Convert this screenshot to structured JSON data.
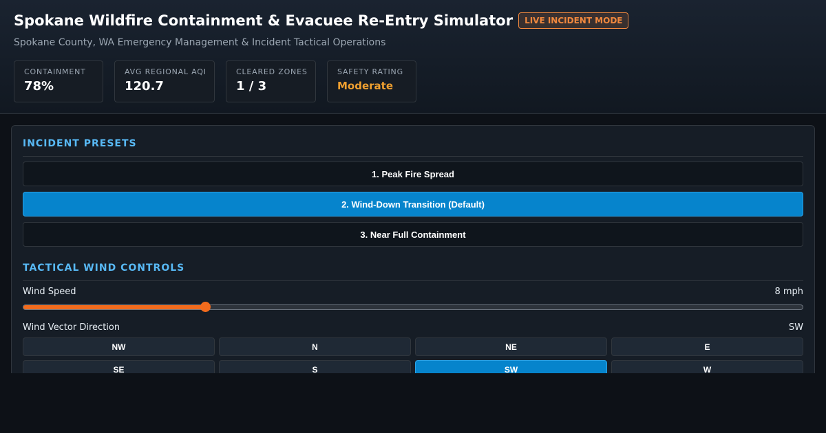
{
  "header": {
    "title": "Spokane Wildfire Containment & Evacuee Re-Entry Simulator",
    "live_badge": "LIVE INCIDENT MODE",
    "subtitle": "Spokane County, WA Emergency Management & Incident Tactical Operations"
  },
  "stats": {
    "containment": {
      "label": "CONTAINMENT",
      "value": "78%"
    },
    "aqi": {
      "label": "AVG REGIONAL AQI",
      "value": "120.7"
    },
    "zones": {
      "label": "CLEARED ZONES",
      "value": "1 / 3"
    },
    "safety": {
      "label": "SAFETY RATING",
      "value": "Moderate",
      "color": "#f0a030"
    }
  },
  "presets": {
    "section_title": "INCIDENT PRESETS",
    "items": [
      {
        "label": "1. Peak Fire Spread",
        "active": false
      },
      {
        "label": "2. Wind-Down Transition (Default)",
        "active": true
      },
      {
        "label": "3. Near Full Containment",
        "active": false
      }
    ]
  },
  "wind": {
    "section_title": "TACTICAL WIND CONTROLS",
    "speed_label": "Wind Speed",
    "speed_value": "8 mph",
    "speed_fraction": 0.233,
    "direction_label": "Wind Vector Direction",
    "direction_value": "SW",
    "directions": [
      "NW",
      "N",
      "NE",
      "E",
      "SE",
      "S",
      "SW",
      "W"
    ],
    "selected_direction": "SW"
  },
  "colors": {
    "accent": "#0684cc",
    "slider": "#f26b1d",
    "live": "#f0883e",
    "section": "#58b9f5"
  }
}
